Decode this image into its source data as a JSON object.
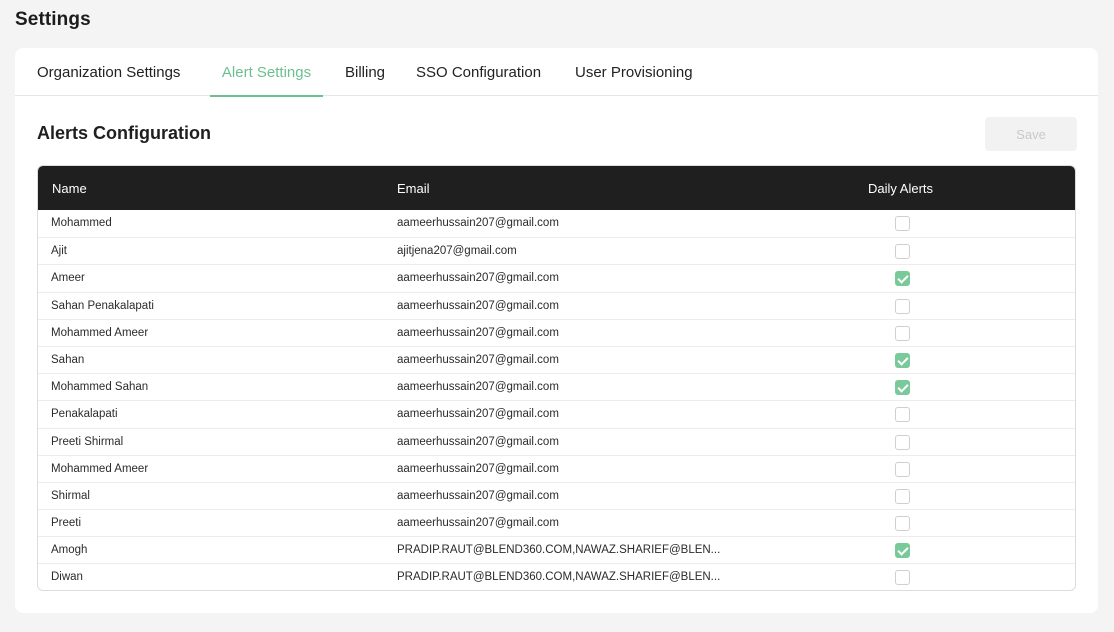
{
  "page_title": "Settings",
  "tabs": [
    {
      "label": "Organization Settings",
      "active": false
    },
    {
      "label": "Alert Settings",
      "active": true
    },
    {
      "label": "Billing",
      "active": false
    },
    {
      "label": "SSO Configuration",
      "active": false
    },
    {
      "label": "User Provisioning",
      "active": false
    }
  ],
  "section_title": "Alerts Configuration",
  "save_label": "Save",
  "colors": {
    "accent": "#6cc08e",
    "header_bg": "#1f1f1f",
    "checked": "#79c99a"
  },
  "table": {
    "headers": {
      "name": "Name",
      "email": "Email",
      "daily_alerts": "Daily Alerts"
    },
    "rows": [
      {
        "name": "Mohammed",
        "email": "aameerhussain207@gmail.com",
        "daily": false
      },
      {
        "name": "Ajit",
        "email": "ajitjena207@gmail.com",
        "daily": false
      },
      {
        "name": "Ameer",
        "email": "aameerhussain207@gmail.com",
        "daily": true
      },
      {
        "name": "Sahan Penakalapati",
        "email": "aameerhussain207@gmail.com",
        "daily": false
      },
      {
        "name": "Mohammed Ameer",
        "email": "aameerhussain207@gmail.com",
        "daily": false
      },
      {
        "name": "Sahan",
        "email": "aameerhussain207@gmail.com",
        "daily": true
      },
      {
        "name": "Mohammed Sahan",
        "email": "aameerhussain207@gmail.com",
        "daily": true
      },
      {
        "name": "Penakalapati",
        "email": "aameerhussain207@gmail.com",
        "daily": false
      },
      {
        "name": "Preeti Shirmal",
        "email": "aameerhussain207@gmail.com",
        "daily": false
      },
      {
        "name": "Mohammed Ameer",
        "email": "aameerhussain207@gmail.com",
        "daily": false
      },
      {
        "name": "Shirmal",
        "email": "aameerhussain207@gmail.com",
        "daily": false
      },
      {
        "name": "Preeti",
        "email": "aameerhussain207@gmail.com",
        "daily": false
      },
      {
        "name": "Amogh",
        "email": "PRADIP.RAUT@BLEND360.COM,NAWAZ.SHARIEF@BLEN...",
        "daily": true
      },
      {
        "name": "Diwan",
        "email": "PRADIP.RAUT@BLEND360.COM,NAWAZ.SHARIEF@BLEN...",
        "daily": false
      }
    ]
  }
}
